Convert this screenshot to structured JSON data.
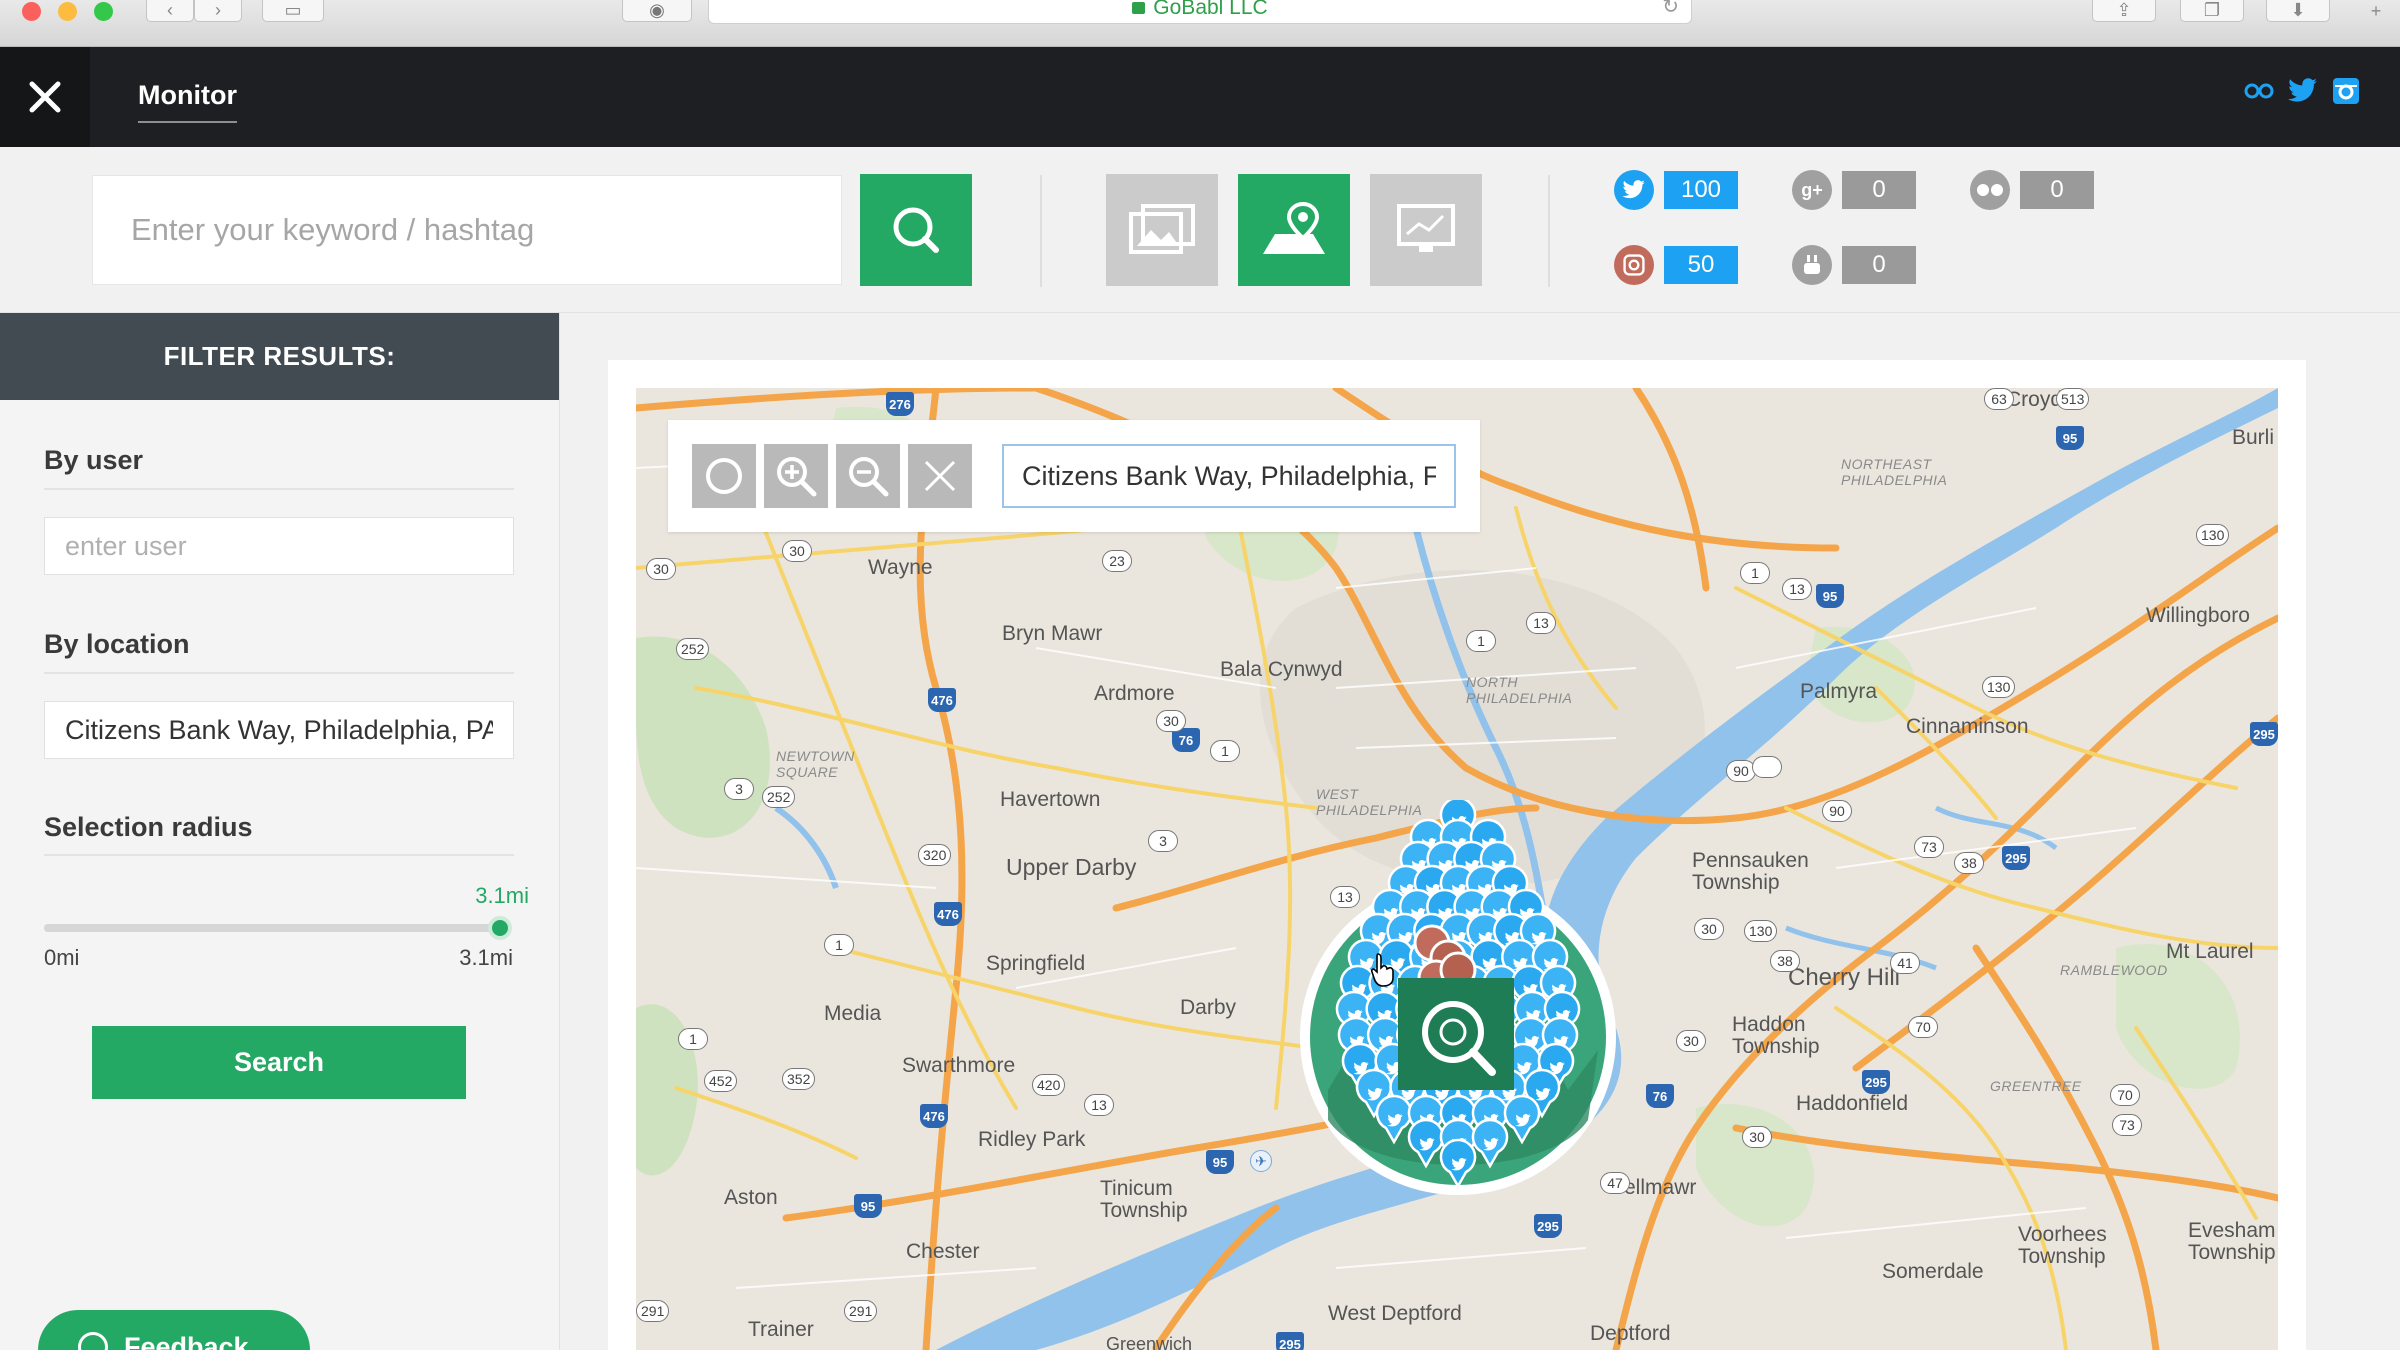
{
  "browser": {
    "url": "GoBabl LLC",
    "traffic_colors": [
      "#fc605c",
      "#fdbc40",
      "#34c84a"
    ]
  },
  "header": {
    "close_icon": "close-icon",
    "tab_label": "Monitor",
    "social_icons": [
      "flickr-icon",
      "twitter-icon",
      "instagram-icon"
    ]
  },
  "toolbar": {
    "keyword_placeholder": "Enter your keyword / hashtag",
    "search_icon": "search-icon",
    "view_modes": [
      {
        "name": "gallery-view",
        "icon": "photo-gallery-icon",
        "active": false
      },
      {
        "name": "map-view",
        "icon": "map-pin-icon",
        "active": true
      },
      {
        "name": "analytics-view",
        "icon": "monitor-chart-icon",
        "active": false
      }
    ],
    "stats": [
      {
        "network": "twitter",
        "icon": "twitter-icon",
        "count": "100",
        "color": "#1da1f2"
      },
      {
        "network": "google-plus",
        "icon": "google-plus-icon",
        "count": "0",
        "color": "#9a9a9a"
      },
      {
        "network": "flickr",
        "icon": "flickr-icon",
        "count": "0",
        "color": "#9a9a9a"
      },
      {
        "network": "instagram",
        "icon": "instagram-icon",
        "count": "50",
        "color": "#1da1f2"
      },
      {
        "network": "youtube",
        "icon": "youtube-icon",
        "count": "0",
        "color": "#9a9a9a"
      }
    ]
  },
  "sidebar": {
    "title": "FILTER RESULTS:",
    "by_user_label": "By user",
    "user_placeholder": "enter user",
    "by_location_label": "By location",
    "location_value": "Citizens Bank Way, Philadelphia, PA",
    "radius_label": "Selection radius",
    "radius_value": "3.1mi",
    "radius_fraction": 1.0,
    "radius_min": "0mi",
    "radius_max": "3.1mi",
    "search_label": "Search",
    "feedback_label": "Feedback"
  },
  "map": {
    "search_value": "Citizens Bank Way, Philadelphia, F",
    "tools": [
      "circle-select-icon",
      "zoom-in-icon",
      "zoom-out-icon",
      "clear-icon"
    ],
    "places": [
      "Croydon",
      "Burli",
      "NORTHEAST PHILADELPHIA",
      "Wayne",
      "Bryn Mawr",
      "Bala Cynwyd",
      "Ardmore",
      "NORTH PHILADELPHIA",
      "Willingboro",
      "Palmyra",
      "Cinnaminson",
      "NEWTOWN SQUARE",
      "Havertown",
      "WEST PHILADELPHIA",
      "Upper Darby",
      "Pennsauken Township",
      "Springfield",
      "Cherry Hill",
      "Mt Laurel",
      "RAMBLEWOOD",
      "Media",
      "Darby",
      "Haddon Township",
      "Swarthmore",
      "Ridley Park",
      "Haddonfield",
      "GREENTREE",
      "Tinicum Township",
      "Aston",
      "Bellmawr",
      "Chester",
      "Voorhees Township",
      "Evesham Township",
      "Somerdale",
      "West Deptford",
      "Deptford",
      "Trainer",
      "Greenwich"
    ]
  },
  "cluster": {
    "tweet_count": "100",
    "instagram_count": "50"
  }
}
